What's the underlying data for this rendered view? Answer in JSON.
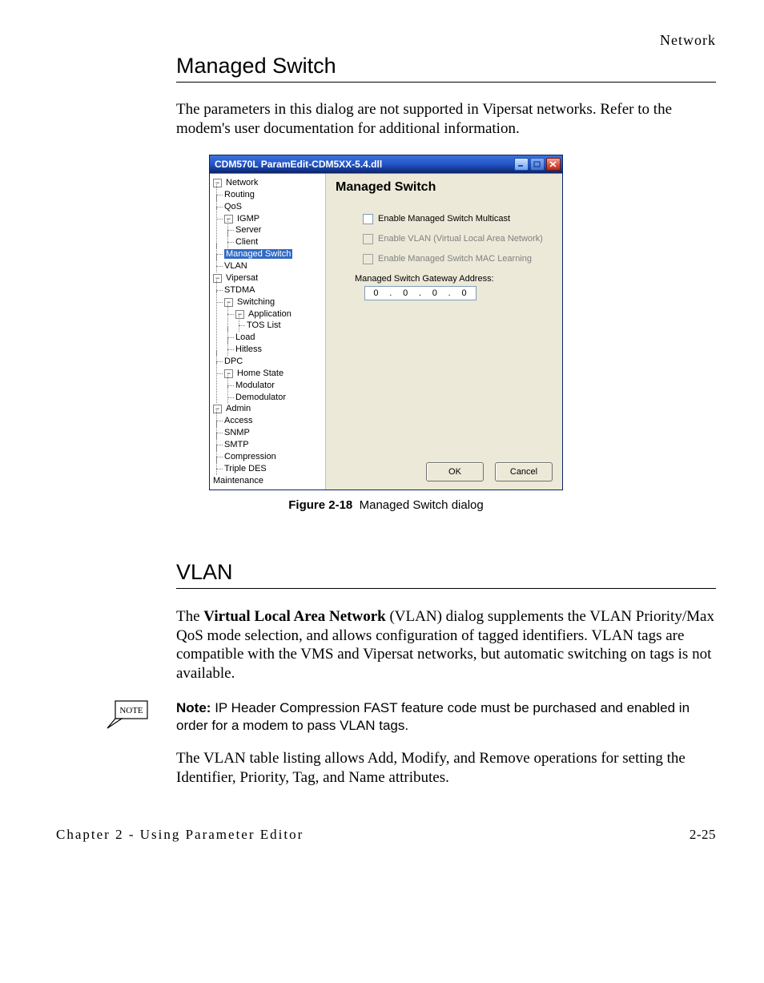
{
  "header": {
    "right": "Network"
  },
  "sections": {
    "managed_switch": {
      "heading": "Managed Switch",
      "intro": "The parameters in this dialog are not supported in Vipersat networks. Refer to the modem's user documentation for additional information."
    },
    "vlan": {
      "heading": "VLAN",
      "intro": "The Virtual Local Area Network (VLAN) dialog supplements the VLAN Priority/Max QoS mode selection, and allows configuration of tagged identifiers. VLAN tags are compatible with the VMS and Vipersat networks, but automatic switching on tags is not available.",
      "note_label": "Note:",
      "note_body": "IP Header Compression FAST feature code must be purchased and enabled in order for a modem to pass VLAN tags.",
      "after_note": "The VLAN table listing allows Add, Modify, and Remove operations for setting the Identifier, Priority, Tag, and Name attributes."
    }
  },
  "figure": {
    "label": "Figure 2-18",
    "caption": "Managed Switch dialog"
  },
  "dialog": {
    "title": "CDM570L ParamEdit-CDM5XX-5.4.dll",
    "pane_title": "Managed Switch",
    "cb_multicast": "Enable Managed Switch Multicast",
    "cb_vlan": "Enable VLAN (Virtual Local Area Network)",
    "cb_mac": "Enable Managed Switch MAC Learning",
    "gw_label": "Managed Switch Gateway Address:",
    "ip": {
      "o1": "0",
      "o2": "0",
      "o3": "0",
      "o4": "0"
    },
    "ok": "OK",
    "cancel": "Cancel",
    "tree": {
      "network": "Network",
      "routing": "Routing",
      "qos": "QoS",
      "igmp": "IGMP",
      "server": "Server",
      "client": "Client",
      "managed_switch": "Managed Switch",
      "vlan": "VLAN",
      "vipersat": "Vipersat",
      "stdma": "STDMA",
      "switching": "Switching",
      "application": "Application",
      "toslist": "TOS List",
      "load": "Load",
      "hitless": "Hitless",
      "dpc": "DPC",
      "home_state": "Home State",
      "modulator": "Modulator",
      "demodulator": "Demodulator",
      "admin": "Admin",
      "access": "Access",
      "snmp": "SNMP",
      "smtp": "SMTP",
      "compression": "Compression",
      "tripledes": "Triple DES",
      "maintenance": "Maintenance"
    }
  },
  "note_icon_text": "NOTE",
  "footer": {
    "chapter": "Chapter 2 - Using Parameter Editor",
    "page": "2-25"
  }
}
